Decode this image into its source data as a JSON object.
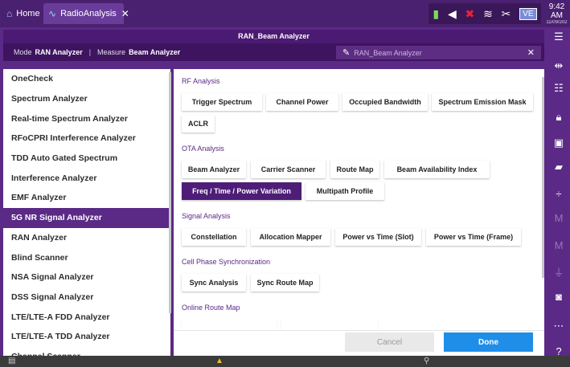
{
  "tabs": {
    "home_label": "Home",
    "app_label": "RadioAnalysis",
    "close_glyph": "✕"
  },
  "status": {
    "ve_label": "VE",
    "time": "9:42 AM",
    "date": "11/09/202"
  },
  "header": {
    "title": "RAN_Beam Analyzer",
    "mode_label": "Mode",
    "mode_value": "RAN Analyzer",
    "measure_label": "Measure",
    "measure_value": "Beam Analyzer",
    "separator": "|",
    "search_value": "RAN_Beam Analyzer"
  },
  "left_list": {
    "items": [
      {
        "label": "OneCheck"
      },
      {
        "label": "Spectrum Analyzer"
      },
      {
        "label": "Real-time Spectrum Analyzer"
      },
      {
        "label": "RFoCPRI Interference Analyzer"
      },
      {
        "label": "TDD Auto Gated Spectrum"
      },
      {
        "label": "Interference Analyzer"
      },
      {
        "label": "EMF Analyzer"
      },
      {
        "label": "5G NR Signal Analyzer"
      },
      {
        "label": "RAN Analyzer"
      },
      {
        "label": "Blind Scanner"
      },
      {
        "label": "NSA Signal Analyzer"
      },
      {
        "label": "DSS Signal Analyzer"
      },
      {
        "label": "LTE/LTE-A FDD Analyzer"
      },
      {
        "label": "LTE/LTE-A TDD Analyzer"
      },
      {
        "label": "Channel Scanner"
      }
    ],
    "selected_index": 7
  },
  "sections": {
    "rf": {
      "title": "RF Analysis",
      "buttons": [
        "Trigger Spectrum",
        "Channel Power",
        "Occupied Bandwidth",
        "Spectrum Emission Mask",
        "ACLR"
      ]
    },
    "ota": {
      "title": "OTA Analysis",
      "buttons": [
        "Beam Analyzer",
        "Carrier Scanner",
        "Route Map",
        "Beam Availability Index",
        "Freq / Time / Power Variation",
        "Multipath Profile"
      ],
      "selected": "Freq / Time / Power Variation"
    },
    "signal": {
      "title": "Signal Analysis",
      "buttons": [
        "Constellation",
        "Allocation Mapper",
        "Power vs Time (Slot)",
        "Power vs Time (Frame)"
      ]
    },
    "cps": {
      "title": "Cell Phase Synchronization",
      "buttons": [
        "Sync Analysis",
        "Sync Route Map"
      ]
    },
    "orm": {
      "title": "Online Route Map"
    }
  },
  "footer": {
    "cancel_label": "Cancel",
    "done_label": "Done"
  },
  "colors": {
    "brand_purple": "#5b2a86",
    "selected_purple": "#4e1d78",
    "done_blue": "#1f8ee8"
  },
  "toolbar_icons": [
    "menu-icon",
    "sliders-icon",
    "grid-icon",
    "lock-icon",
    "save-icon",
    "folder-icon",
    "divide-icon",
    "marker-icon",
    "marker-icon",
    "pulse-icon",
    "camera-icon",
    "more-icon",
    "help-icon"
  ]
}
